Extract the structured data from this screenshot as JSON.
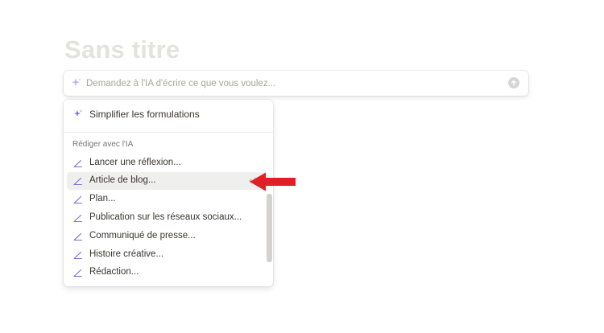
{
  "page": {
    "title": "Sans titre"
  },
  "ai_bar": {
    "placeholder": "Demandez à l'IA d'écrire ce que vous voulez..."
  },
  "menu": {
    "top_item": {
      "label": "Simplifier les formulations",
      "icon": "sparkle-icon"
    },
    "section_header": "Rédiger avec l'IA",
    "items": [
      {
        "label": "Lancer une réflexion...",
        "icon": "pen-icon"
      },
      {
        "label": "Article de blog...",
        "icon": "pen-icon"
      },
      {
        "label": "Plan...",
        "icon": "pen-icon"
      },
      {
        "label": "Publication sur les réseaux sociaux...",
        "icon": "pen-icon"
      },
      {
        "label": "Communiqué de presse...",
        "icon": "pen-icon"
      },
      {
        "label": "Histoire créative...",
        "icon": "pen-icon"
      },
      {
        "label": "Rédaction...",
        "icon": "pen-icon"
      }
    ],
    "highlighted_index": 1
  },
  "colors": {
    "accent": "#7a6fd6",
    "arrow": "#e21e26",
    "title": "#e3e2e0",
    "hover": "#efefee"
  }
}
